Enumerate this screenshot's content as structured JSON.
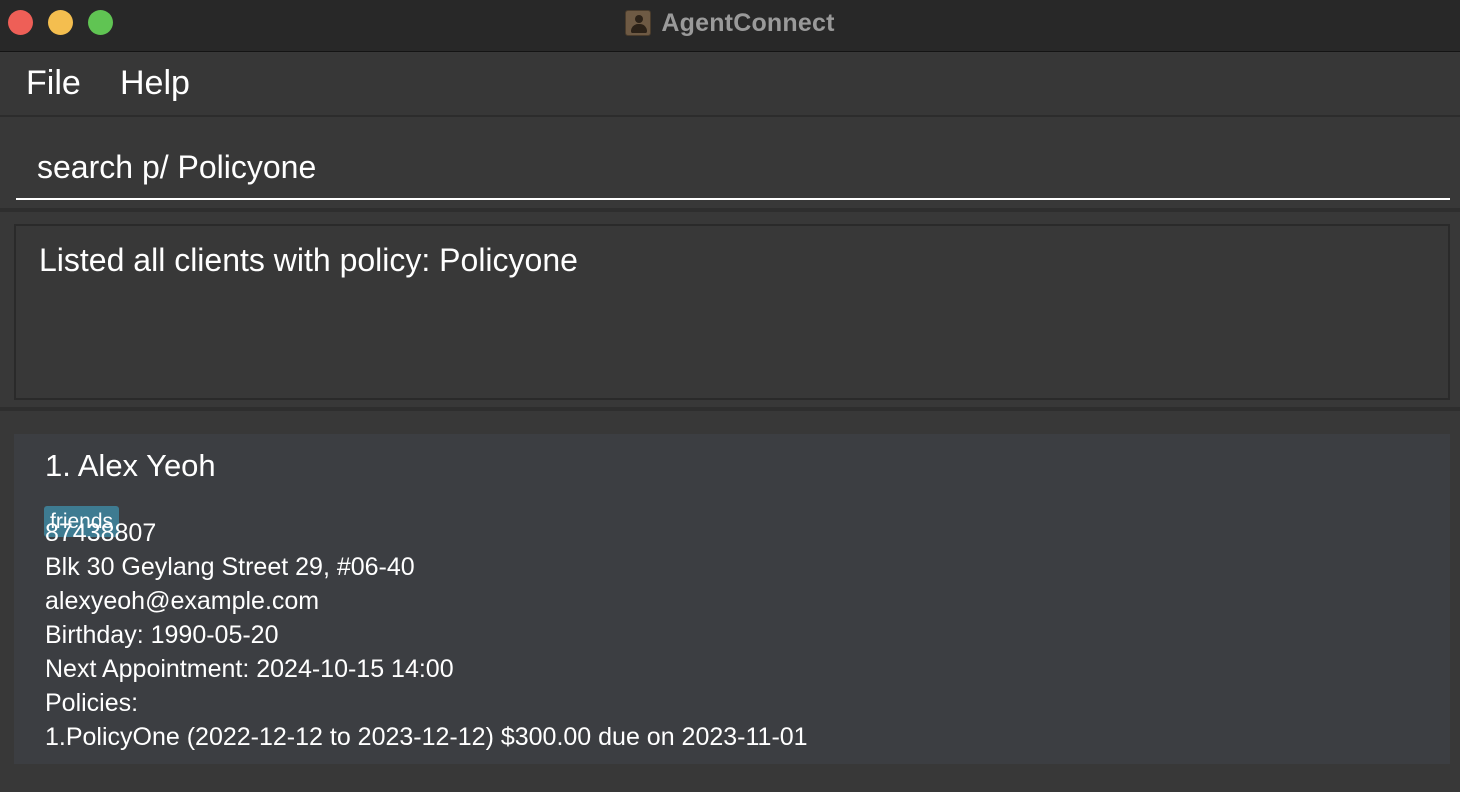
{
  "window": {
    "title": "AgentConnect"
  },
  "menu": {
    "file": "File",
    "help": "Help"
  },
  "command": {
    "value": "search p/ Policyone"
  },
  "result": {
    "message": "Listed all clients with policy: Policyone"
  },
  "persons": [
    {
      "name": "1. Alex Yeoh",
      "tags": [
        "friends"
      ],
      "phone": "87438807",
      "address": "Blk 30 Geylang Street 29, #06-40",
      "email": "alexyeoh@example.com",
      "birthday": "Birthday: 1990-05-20",
      "appointment": "Next Appointment: 2024-10-15 14:00",
      "policies_label": "Policies:",
      "policies": [
        "1.PolicyOne (2022-12-12 to 2023-12-12) $300.00 due on 2023-11-01"
      ]
    }
  ],
  "colors": {
    "tag": "#3e7b91",
    "close": "#ee5f57",
    "minimize": "#f4be4f",
    "maximize": "#60c453"
  },
  "icons": {
    "app": "contact-book-icon"
  }
}
